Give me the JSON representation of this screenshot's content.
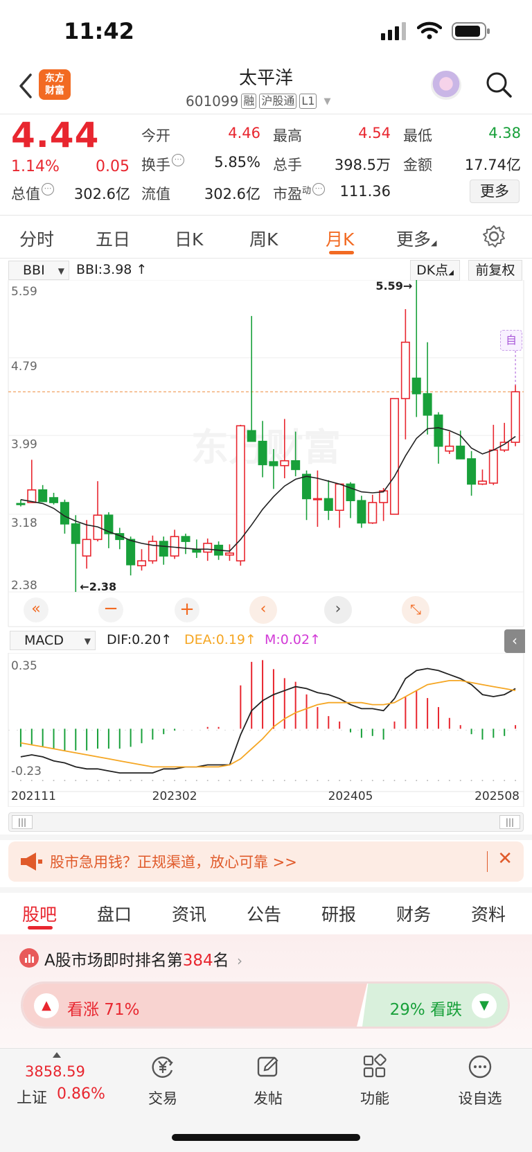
{
  "status_bar": {
    "time": "11:42"
  },
  "header": {
    "logo_text_1": "东方",
    "logo_text_2": "财富",
    "title": "太平洋",
    "code": "601099",
    "tags": [
      "融",
      "沪股通",
      "L1"
    ]
  },
  "quote": {
    "price": "4.44",
    "change_pct": "1.14%",
    "change": "0.05",
    "fields": [
      {
        "label": "今开",
        "value": "4.46",
        "color": "red"
      },
      {
        "label": "最高",
        "value": "4.54",
        "color": "red"
      },
      {
        "label": "最低",
        "value": "4.38",
        "color": "green"
      },
      {
        "label": "换手",
        "value": "5.85%",
        "color": "normal"
      },
      {
        "label": "总手",
        "value": "398.5万",
        "color": "normal"
      },
      {
        "label": "金额",
        "value": "17.74亿",
        "color": "normal"
      },
      {
        "label": "总值",
        "value": "302.6亿",
        "color": "normal"
      },
      {
        "label": "流值",
        "value": "302.6亿",
        "color": "normal"
      },
      {
        "label": "市盈",
        "value": "111.36",
        "color": "normal"
      }
    ],
    "pe_superscript": "动",
    "more": "更多"
  },
  "period_tabs": [
    "分时",
    "五日",
    "日K",
    "周K",
    "月K",
    "更多"
  ],
  "active_period": "月K",
  "chart_toolbar": {
    "indicator": "BBI",
    "indicator_value": "BBI:3.98",
    "dk_label": "DK点",
    "adjust_label": "前复权",
    "auto_label": "自"
  },
  "sub_toolbar": {
    "indicator": "MACD",
    "dif": "DIF:0.20",
    "dea": "DEA:0.19",
    "m": "M:0.02"
  },
  "chart_data": [
    {
      "type": "candlestick",
      "y_ticks": [
        "5.59",
        "4.79",
        "3.99",
        "3.18",
        "2.38"
      ],
      "ylim": [
        2.38,
        5.59
      ],
      "max_label": "5.59",
      "min_label": "2.38",
      "last_close": 4.44,
      "ohlc": [
        [
          3.29,
          3.33,
          3.26,
          3.28
        ],
        [
          3.3,
          3.74,
          3.3,
          3.43
        ],
        [
          3.43,
          3.48,
          3.35,
          3.31
        ],
        [
          3.35,
          3.4,
          3.28,
          3.3
        ],
        [
          3.3,
          3.33,
          2.98,
          3.08
        ],
        [
          3.08,
          3.17,
          2.38,
          2.88
        ],
        [
          2.75,
          3.12,
          2.62,
          2.92
        ],
        [
          2.92,
          3.52,
          2.9,
          3.17
        ],
        [
          3.17,
          3.2,
          2.83,
          2.98
        ],
        [
          2.98,
          3.04,
          2.82,
          2.92
        ],
        [
          2.92,
          2.95,
          2.55,
          2.66
        ],
        [
          2.65,
          2.82,
          2.6,
          2.7
        ],
        [
          2.7,
          2.96,
          2.67,
          2.9
        ],
        [
          2.9,
          2.95,
          2.66,
          2.75
        ],
        [
          2.75,
          3.02,
          2.72,
          2.95
        ],
        [
          2.95,
          2.98,
          2.77,
          2.9
        ],
        [
          2.82,
          2.92,
          2.73,
          2.79
        ],
        [
          2.79,
          2.93,
          2.7,
          2.88
        ],
        [
          2.86,
          2.9,
          2.71,
          2.76
        ],
        [
          2.76,
          2.87,
          2.7,
          2.78
        ],
        [
          2.7,
          4.1,
          2.65,
          4.09
        ],
        [
          4.04,
          5.22,
          3.96,
          3.93
        ],
        [
          3.93,
          4.14,
          3.56,
          3.69
        ],
        [
          3.72,
          3.85,
          3.44,
          3.68
        ],
        [
          3.68,
          4.16,
          3.55,
          3.73
        ],
        [
          3.73,
          4.03,
          3.57,
          3.64
        ],
        [
          3.59,
          3.63,
          3.12,
          3.34
        ],
        [
          3.34,
          3.63,
          3.05,
          3.34
        ],
        [
          3.34,
          3.53,
          3.12,
          3.22
        ],
        [
          3.22,
          3.48,
          3.04,
          3.49
        ],
        [
          3.49,
          3.51,
          3.14,
          3.32
        ],
        [
          3.32,
          3.37,
          3.04,
          3.09
        ],
        [
          3.09,
          3.38,
          3.08,
          3.3
        ],
        [
          3.3,
          3.45,
          3.11,
          3.42
        ],
        [
          3.18,
          4.37,
          3.18,
          4.37
        ],
        [
          4.37,
          5.29,
          3.95,
          4.95
        ],
        [
          4.58,
          5.59,
          4.18,
          4.42
        ],
        [
          4.42,
          4.95,
          4.0,
          4.2
        ],
        [
          4.2,
          4.23,
          3.7,
          3.88
        ],
        [
          3.83,
          4.03,
          3.8,
          3.88
        ],
        [
          3.88,
          4.04,
          3.75,
          3.75
        ],
        [
          3.75,
          3.83,
          3.37,
          3.49
        ],
        [
          3.49,
          3.64,
          3.48,
          3.52
        ],
        [
          3.5,
          4.1,
          3.48,
          3.84
        ],
        [
          3.84,
          4.12,
          3.82,
          3.92
        ],
        [
          3.92,
          4.51,
          3.88,
          4.44
        ]
      ],
      "bbi": [
        3.33,
        3.31,
        3.29,
        3.24,
        3.16,
        3.11,
        3.07,
        3.05,
        3.0,
        2.96,
        2.91,
        2.88,
        2.86,
        2.85,
        2.84,
        2.83,
        2.82,
        2.82,
        2.81,
        2.8,
        2.92,
        3.07,
        3.23,
        3.36,
        3.47,
        3.54,
        3.57,
        3.55,
        3.52,
        3.49,
        3.45,
        3.41,
        3.4,
        3.41,
        3.57,
        3.78,
        3.96,
        4.06,
        4.07,
        4.04,
        3.99,
        3.86,
        3.8,
        3.84,
        3.9,
        3.98
      ]
    },
    {
      "type": "macd",
      "y_ticks": [
        "0.35",
        "-0.23"
      ],
      "ylim": [
        -0.23,
        0.35
      ],
      "x_labels": [
        "202111",
        "202302",
        "202405",
        "202508"
      ],
      "dif": [
        -0.14,
        -0.13,
        -0.14,
        -0.16,
        -0.17,
        -0.19,
        -0.2,
        -0.2,
        -0.21,
        -0.22,
        -0.22,
        -0.22,
        -0.22,
        -0.2,
        -0.2,
        -0.19,
        -0.19,
        -0.18,
        -0.18,
        -0.18,
        -0.03,
        0.09,
        0.14,
        0.17,
        0.19,
        0.21,
        0.2,
        0.18,
        0.17,
        0.15,
        0.12,
        0.1,
        0.1,
        0.09,
        0.15,
        0.25,
        0.29,
        0.3,
        0.29,
        0.27,
        0.25,
        0.22,
        0.17,
        0.16,
        0.17,
        0.2
      ],
      "dea": [
        -0.07,
        -0.08,
        -0.09,
        -0.1,
        -0.11,
        -0.12,
        -0.13,
        -0.14,
        -0.15,
        -0.16,
        -0.17,
        -0.18,
        -0.19,
        -0.19,
        -0.19,
        -0.19,
        -0.19,
        -0.19,
        -0.19,
        -0.18,
        -0.15,
        -0.1,
        -0.05,
        0.01,
        0.05,
        0.08,
        0.1,
        0.12,
        0.13,
        0.13,
        0.13,
        0.13,
        0.12,
        0.12,
        0.13,
        0.16,
        0.19,
        0.22,
        0.23,
        0.24,
        0.24,
        0.23,
        0.22,
        0.21,
        0.2,
        0.19
      ],
      "m": [
        -0.1,
        -0.09,
        -0.1,
        -0.11,
        -0.12,
        -0.12,
        -0.12,
        -0.11,
        -0.11,
        -0.11,
        -0.1,
        -0.08,
        -0.06,
        -0.03,
        -0.01,
        0.0,
        0.0,
        0.01,
        0.01,
        0.0,
        0.24,
        0.37,
        0.38,
        0.33,
        0.28,
        0.26,
        0.19,
        0.12,
        0.07,
        0.04,
        -0.02,
        -0.05,
        -0.04,
        -0.06,
        0.04,
        0.18,
        0.21,
        0.17,
        0.12,
        0.06,
        0.02,
        -0.03,
        -0.06,
        -0.05,
        -0.04,
        0.02
      ]
    }
  ],
  "promo": {
    "text": "股市急用钱？正规渠道，放心可靠 >>"
  },
  "content_tabs": [
    "股吧",
    "盘口",
    "资讯",
    "公告",
    "研报",
    "财务",
    "资料"
  ],
  "active_content_tab": "股吧",
  "ranking": {
    "prefix": "A股市场即时排名第",
    "rank": "384",
    "suffix": "名"
  },
  "vote": {
    "up_label": "看涨 71%",
    "down_label": "29% 看跌",
    "up_fraction": 0.71
  },
  "bottom_nav": {
    "index_value": "3858.59",
    "index_name": "上证",
    "index_pct": "0.86%",
    "items": [
      "交易",
      "发帖",
      "功能",
      "设自选"
    ]
  },
  "colors": {
    "up": "#e8262f",
    "down": "#18a03a",
    "accent": "#f26a22",
    "dea": "#f5a623",
    "m_line": "#d23ad6"
  }
}
